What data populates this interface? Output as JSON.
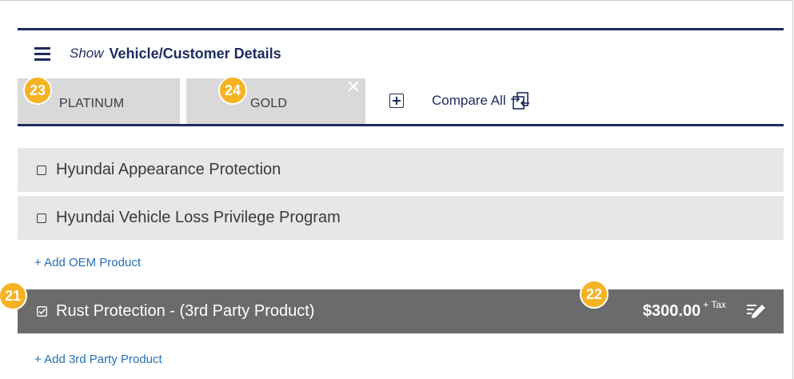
{
  "header": {
    "show_label": "Show",
    "details_label": "Vehicle/Customer Details"
  },
  "tabs": [
    {
      "label": "PLATINUM",
      "marker": "23"
    },
    {
      "label": "GOLD",
      "marker": "24",
      "close": "✕"
    }
  ],
  "toolbar": {
    "compare_all_label": "Compare All"
  },
  "oem_products": [
    {
      "label": "Hyundai Appearance Protection",
      "checked": false
    },
    {
      "label": "Hyundai Vehicle Loss Privilege Program",
      "checked": false
    }
  ],
  "add_oem_label": "+ Add OEM Product",
  "third_party_products": [
    {
      "label": "Rust Protection - (3rd Party Product)",
      "checked": true,
      "marker": "21",
      "price": "$300.00",
      "price_suffix": "+ Tax",
      "price_marker": "22"
    }
  ],
  "add_3rd_label": "+ Add 3rd Party Product",
  "colors": {
    "navy": "#1f2b5e",
    "marker": "#f5b223",
    "link": "#2670b3",
    "selected_row": "#6b6b6b",
    "row": "#e7e7e7",
    "tab": "#d9d9d9"
  },
  "icons": {
    "menu": "hamburger-menu-icon",
    "add_tab": "plus-square-icon",
    "compare": "compare-arrows-icon",
    "checkbox": "checkbox-icon",
    "edit": "edit-pencil-icon"
  }
}
